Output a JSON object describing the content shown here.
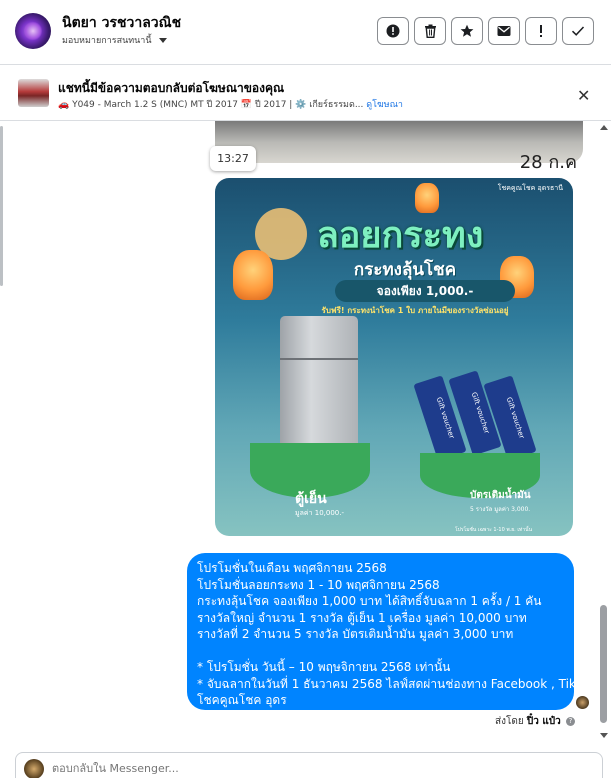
{
  "header": {
    "user_name": "นิตยา วรชวาลวณิช",
    "assign_label": "มอบหมายการสนทนานี้",
    "actions": [
      {
        "name": "alert-icon",
        "glyph": "●",
        "label": "!"
      },
      {
        "name": "trash-icon",
        "glyph": "▤"
      },
      {
        "name": "star-icon",
        "glyph": "★"
      },
      {
        "name": "envelope-icon",
        "glyph": "✉"
      },
      {
        "name": "exclamation-icon",
        "glyph": "!"
      },
      {
        "name": "check-icon",
        "glyph": "✓"
      }
    ]
  },
  "context": {
    "title": "แชทนี้มีข้อความตอบกลับต่อโฆษณาของคุณ",
    "meta_prefix": "🚗 Y049 - March 1.2 S (MNC) MT ปี 2017 📅 ปี 2017 | ⚙️ เกียร์ธรรมด...",
    "meta_link": "ดูโฆษณา"
  },
  "chat": {
    "photo_date": "28 ก.ค",
    "time": "13:27",
    "poster": {
      "logo": "โชคคูณโชค อุดรธานี",
      "title": "ลอยกระทง",
      "subtitle": "กระทงลุ้นโชค",
      "price": "จองเพียง 1,000.-",
      "note": "รับฟรี! กระทงนำโชค 1 ใบ ภายในมีของรางวัลซ่อนอยู่",
      "prize1_label": "ตู้เย็น",
      "prize1_value": "มูลค่า 10,000.-",
      "prize2_label": "บัตรเติมน้ำมัน",
      "prize2_value": "5 รางวัล มูลค่า 3,000.",
      "voucher_label": "Gift voucher",
      "foot": "โปรโมชั่น เฉพาะ 1-10 พ.ย. เท่านั้น"
    },
    "message_lines": [
      "โปรโมชั่นในเดือน พฤศจิกายน 2568",
      "โปรโมชั่นลอยกระทง 1 - 10 พฤศจิกายน 2568",
      "กระทงลุ้นโชค จองเพียง 1,000 บาท ได้สิทธิ์จับฉลาก 1 ครั้ง /  1 คัน",
      "รางวัลใหญ่  จำนวน 1 รางวัล   ตู้เย็น  1  เครื่อง  มูลค่า    10,000  บาท",
      "รางวัลที่ 2  จำนวน 5 รางวัล   บัตรเติมน้ำมัน    มูลค่า    3,000    บาท",
      "",
      "* โปรโมชั่น วันนี้ – 10 พฤษจิกายน 2568 เท่านั้น",
      "* จับฉลากในวันที่ 1 ธันวาคม 2568 ไลฟ์สดผ่านช่องทาง Facebook , Tiktok",
      "โชคคูณโชค อุดร"
    ],
    "sent_prefix": "ส่งโดย",
    "sent_by": "ปิ๋ว แป๋ว"
  },
  "composer": {
    "placeholder": "ตอบกลับใน Messenger..."
  }
}
